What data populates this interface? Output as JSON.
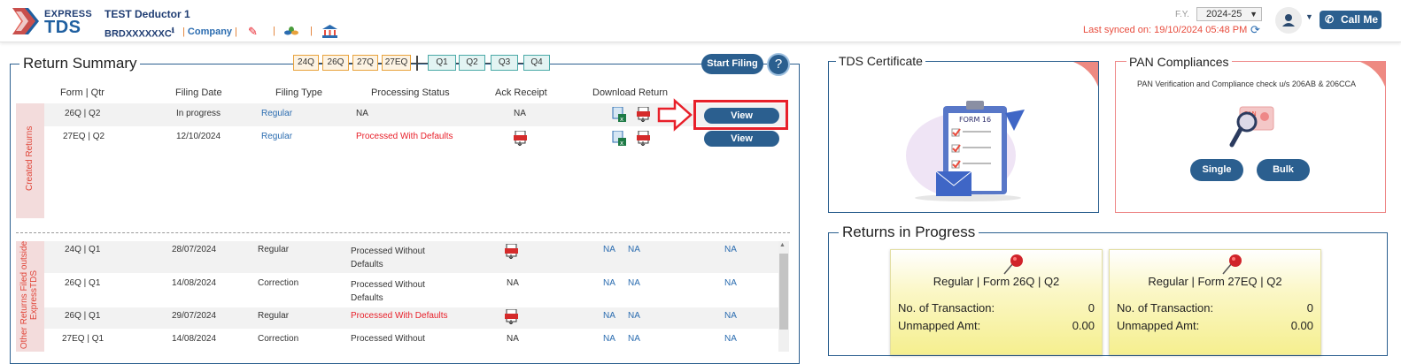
{
  "header": {
    "logo_top": "EXPRESS",
    "logo_bottom": "TDS",
    "deductor_name": "TEST Deductor 1",
    "tan": "BRDXXXXXXC",
    "company_label": "Company",
    "fy_label": "F.Y.",
    "fy_value": "2024-25",
    "last_synced": "Last synced on: 19/10/2024 05:48 PM",
    "call_me": "Call Me"
  },
  "return_summary": {
    "title": "Return Summary",
    "form_chips": [
      "24Q",
      "26Q",
      "27Q",
      "27EQ"
    ],
    "quarter_chips": [
      "Q1",
      "Q2",
      "Q3",
      "Q4"
    ],
    "start_filing": "Start Filing",
    "help": "?",
    "columns": [
      "Form | Qtr",
      "Filing Date",
      "Filing Type",
      "Processing Status",
      "Ack Receipt",
      "Download Return"
    ],
    "created_label": "Created Returns",
    "created_rows": [
      {
        "form": "26Q | Q2",
        "date": "In progress",
        "type": "Regular",
        "status": "NA",
        "ack": "NA",
        "action": "View"
      },
      {
        "form": "27EQ | Q2",
        "date": "12/10/2024",
        "type": "Regular",
        "status": "Processed With Defaults",
        "ack": "",
        "action": "View"
      }
    ],
    "other_label": "Other Returns Filed outside ExpressTDS",
    "other_rows": [
      {
        "form": "24Q | Q1",
        "date": "28/07/2024",
        "type": "Regular",
        "status": "Processed Without Defaults",
        "ack": "",
        "d1": "NA",
        "d2": "NA",
        "d3": "NA"
      },
      {
        "form": "26Q | Q1",
        "date": "14/08/2024",
        "type": "Correction",
        "status": "Processed Without Defaults",
        "ack": "NA",
        "d1": "NA",
        "d2": "NA",
        "d3": "NA"
      },
      {
        "form": "26Q | Q1",
        "date": "29/07/2024",
        "type": "Regular",
        "status": "Processed With Defaults",
        "ack": "",
        "d1": "NA",
        "d2": "NA",
        "d3": "NA"
      },
      {
        "form": "27EQ | Q1",
        "date": "14/08/2024",
        "type": "Correction",
        "status": "Processed Without",
        "ack": "NA",
        "d1": "NA",
        "d2": "NA",
        "d3": "NA"
      }
    ]
  },
  "tds_certificate": {
    "title": "TDS Certificate",
    "form_label": "FORM 16"
  },
  "pan_compliances": {
    "title": "PAN Compliances",
    "subtitle": "PAN Verification and Compliance check u/s 206AB & 206CCA",
    "card_label": "PAN",
    "single": "Single",
    "bulk": "Bulk"
  },
  "returns_in_progress": {
    "title": "Returns in Progress",
    "cards": [
      {
        "title": "Regular | Form 26Q | Q2",
        "txn_label": "No. of Transaction:",
        "txn_value": "0",
        "amt_label": "Unmapped Amt:",
        "amt_value": "0.00"
      },
      {
        "title": "Regular | Form 27EQ | Q2",
        "txn_label": "No. of Transaction:",
        "txn_value": "0",
        "amt_label": "Unmapped Amt:",
        "amt_value": "0.00"
      }
    ]
  },
  "colors": {
    "primary": "#2b5f8f",
    "danger": "#e8202a",
    "accent_orange": "#e8a23c",
    "accent_teal": "#4aa9a7"
  }
}
